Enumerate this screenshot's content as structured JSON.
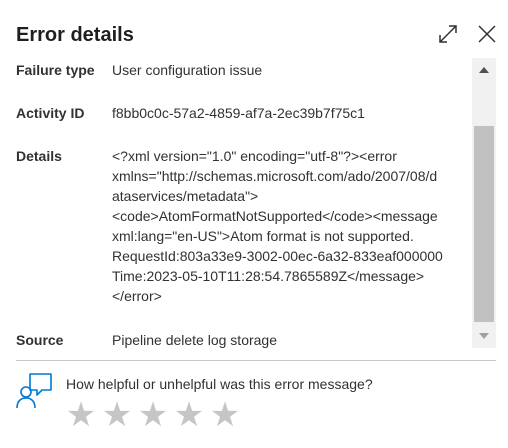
{
  "panel": {
    "title": "Error details"
  },
  "fields": {
    "failure_type": {
      "label": "Failure type",
      "value": "User configuration issue"
    },
    "activity_id": {
      "label": "Activity ID",
      "value": "f8bb0c0c-57a2-4859-af7a-2ec39b7f75c1"
    },
    "details": {
      "label": "Details",
      "lines": [
        "<?xml version=\"1.0\" encoding=\"utf-8\"?><error",
        "xmlns=\"http://schemas.microsoft.com/ado/2007/08/d",
        "ataservices/metadata\">",
        "<code>AtomFormatNotSupported</code><message",
        "xml:lang=\"en-US\">Atom format is not supported.",
        "RequestId:803a33e9-3002-00ec-6a32-833eaf000000",
        "Time:2023-05-10T11:28:54.7865589Z</message>",
        "</error>"
      ]
    },
    "source": {
      "label": "Source",
      "value": "Pipeline delete log storage"
    }
  },
  "feedback": {
    "question": "How helpful or unhelpful was this error message?",
    "rating_max": 5,
    "rating_selected": 0
  },
  "icons": {
    "expand": "expand-icon",
    "close": "close-icon",
    "feedback": "feedback-person-icon",
    "star": "star-icon"
  },
  "colors": {
    "accent": "#0078d4",
    "star_empty": "#c8c6c4",
    "scroll_thumb": "#c1c1c1"
  }
}
